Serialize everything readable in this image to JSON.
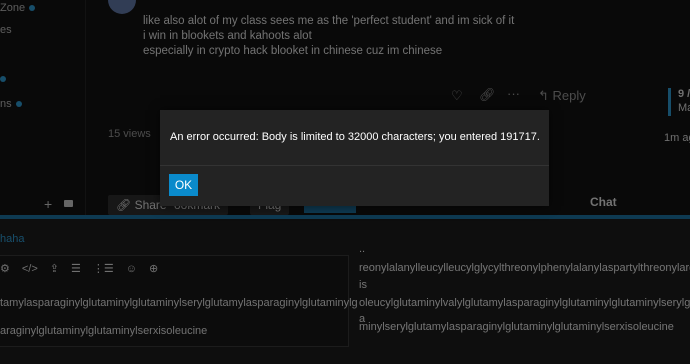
{
  "sidebar": {
    "items": [
      {
        "label": "Zone",
        "dot": true
      },
      {
        "label": "es",
        "dot": false
      },
      {
        "label": "",
        "dot": true
      },
      {
        "label": "ns",
        "dot": true
      }
    ]
  },
  "post": {
    "lines": [
      "like also alot of my class sees me as the 'perfect student' and im sick of it",
      "i win in blookets and kahoots alot",
      "especially in crypto hack blooket in chinese cuz im chinese"
    ],
    "reply_label": "Reply",
    "views": "15 views"
  },
  "timeline": {
    "position": "9 /",
    "label": "Ma",
    "ago": "1m ag"
  },
  "actions": {
    "share": "Share",
    "bookmark": "ookmark",
    "flag": "Flag"
  },
  "chat_label": "Chat",
  "composer": {
    "reply_to": "haha",
    "toolbar_icons": [
      "code-block-icon",
      "html-icon",
      "upload-icon",
      "bullet-list-icon",
      "numbered-list-icon",
      "emoji-icon",
      "plus-icon"
    ],
    "editor_lines": [
      "tamylasparaginylglutaminylglutaminylserylglutamylasparaginylglutaminylg",
      "araginylglutaminylglutaminylserxisoleucine"
    ],
    "preview_lines": [
      "..",
      "reonylalanylleucylleucylglycylthreonylphenylalanylaspartylthreonylarginylal",
      "is",
      "oleucylglutaminylvalylglutamylasparaginylglutaminylglutaminylserylglutamy",
      "a",
      "minylserylglutamylasparaginylglutaminylglutaminylserxisoleucine"
    ]
  },
  "dialog": {
    "message": "An error occurred: Body is limited to 32000 characters; you entered 191717.",
    "ok_label": "OK"
  },
  "colors": {
    "accent": "#0a8acb",
    "link": "#2b8ec2",
    "background": "#111111",
    "modal": "#232323"
  }
}
